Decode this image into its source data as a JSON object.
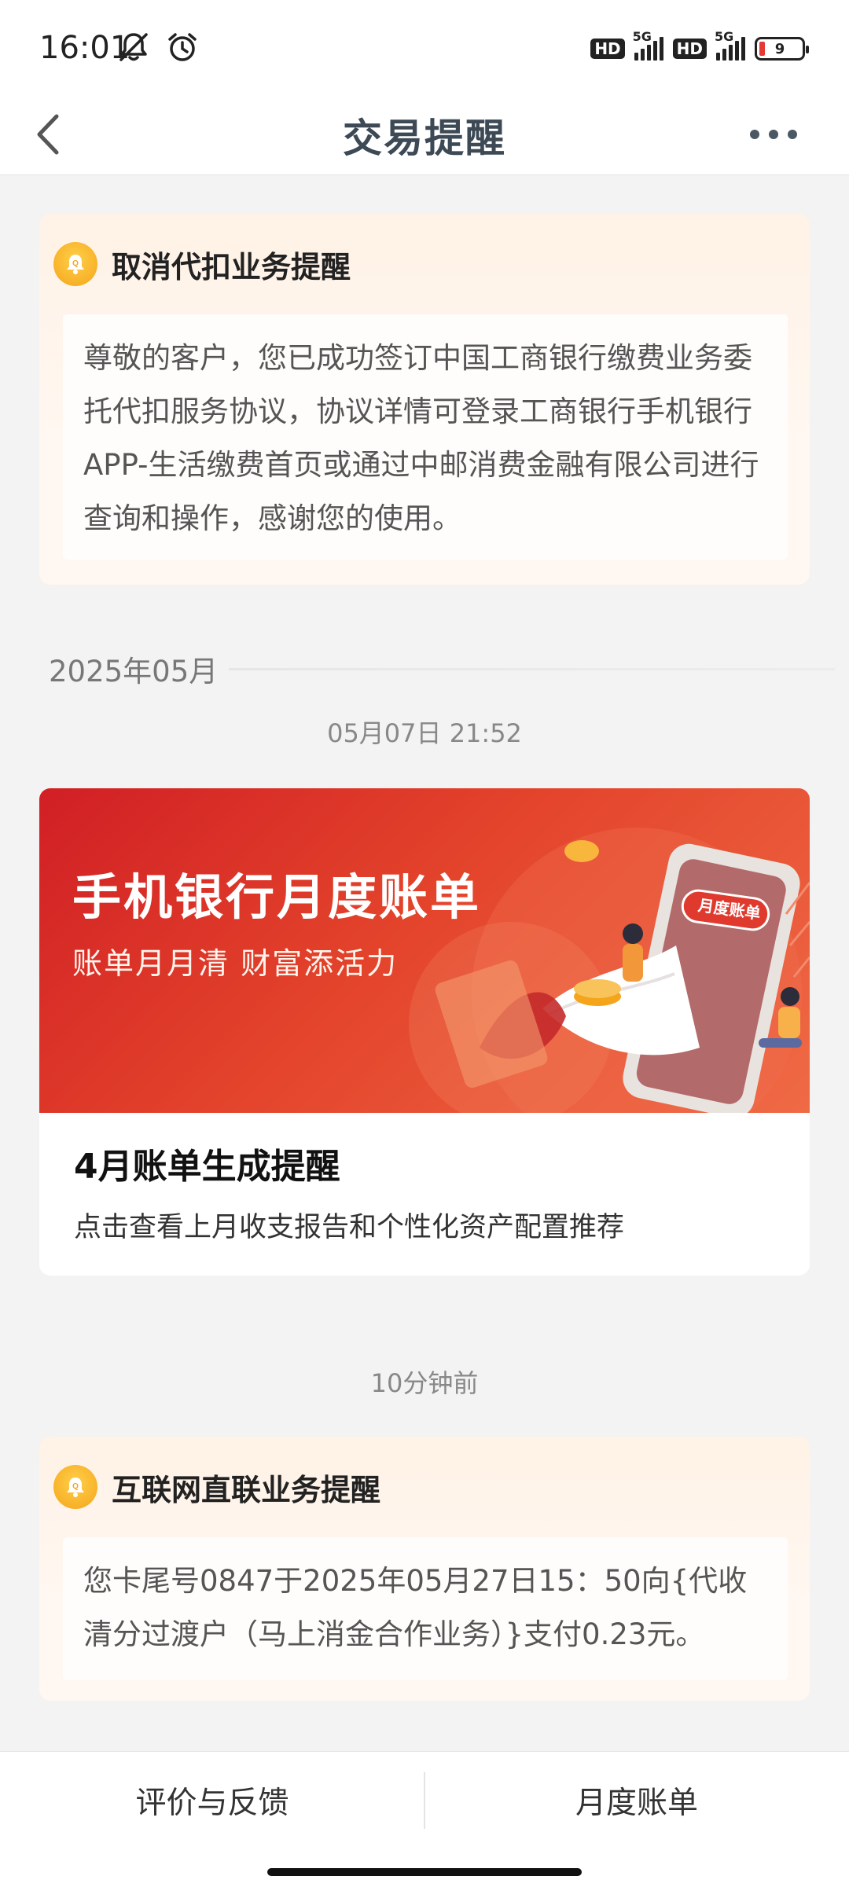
{
  "status_bar": {
    "time": "16:01",
    "battery_level": "9",
    "network_1": "5G",
    "network_2": "5G",
    "hd_1": "HD",
    "hd_2": "HD",
    "icons": [
      "mute-icon",
      "alarm-icon",
      "hd-icon",
      "signal-icon",
      "hd-icon",
      "signal-icon",
      "battery-icon"
    ]
  },
  "nav": {
    "title": "交易提醒"
  },
  "notice_1": {
    "title": "取消代扣业务提醒",
    "body": "尊敬的客户，您已成功签订中国工商银行缴费业务委托代扣服务协议，协议详情可登录工商银行手机银行APP-生活缴费首页或通过中邮消费金融有限公司进行查询和操作，感谢您的使用。"
  },
  "month_divider": "2025年05月",
  "time_1": "05月07日 21:52",
  "bill_card": {
    "banner_title": "手机银行月度账单",
    "banner_subtitle": "账单月月清 财富添活力",
    "banner_tag": "月度账单",
    "title": "4月账单生成提醒",
    "description": "点击查看上月收支报告和个性化资产配置推荐"
  },
  "time_2": "10分钟前",
  "notice_2": {
    "title": "互联网直联业务提醒",
    "body": "您卡尾号0847于2025年05月27日15：50向{代收清分过渡户（马上消金合作业务）}支付0.23元。"
  },
  "bottom_bar": {
    "left_label": "评价与反馈",
    "right_label": "月度账单"
  },
  "colors": {
    "banner_red": "#d11f25",
    "notice_bg": "#fff2e6",
    "bell_yellow": "#f4a51c",
    "title_gray": "#3d4a56"
  }
}
